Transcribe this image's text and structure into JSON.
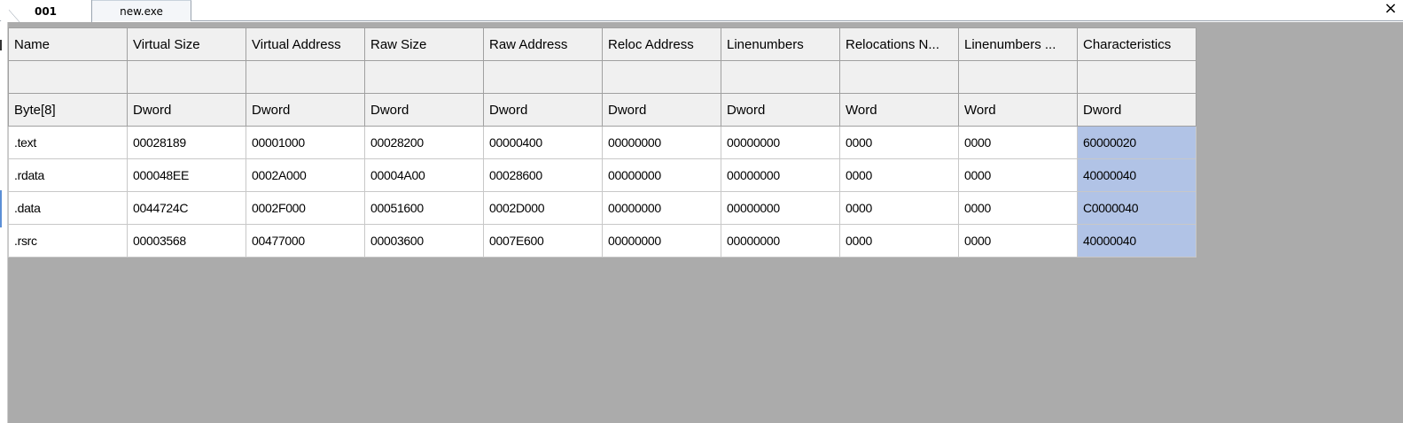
{
  "tabs": [
    {
      "label": "001",
      "active": true
    },
    {
      "label": "new.exe",
      "active": false
    }
  ],
  "close_icon": "×",
  "table": {
    "columns": [
      "Name",
      "Virtual Size",
      "Virtual Address",
      "Raw Size",
      "Raw Address",
      "Reloc Address",
      "Linenumbers",
      "Relocations N...",
      "Linenumbers ...",
      "Characteristics"
    ],
    "types": [
      "Byte[8]",
      "Dword",
      "Dword",
      "Dword",
      "Dword",
      "Dword",
      "Dword",
      "Word",
      "Word",
      "Dword"
    ],
    "rows": [
      [
        ".text",
        "00028189",
        "00001000",
        "00028200",
        "00000400",
        "00000000",
        "00000000",
        "0000",
        "0000",
        "60000020"
      ],
      [
        ".rdata",
        "000048EE",
        "0002A000",
        "00004A00",
        "00028600",
        "00000000",
        "00000000",
        "0000",
        "0000",
        "40000040"
      ],
      [
        ".data",
        "0044724C",
        "0002F000",
        "00051600",
        "0002D000",
        "00000000",
        "00000000",
        "0000",
        "0000",
        "C0000040"
      ],
      [
        ".rsrc",
        "00003568",
        "00477000",
        "00003600",
        "0007E600",
        "00000000",
        "00000000",
        "0000",
        "0000",
        "40000040"
      ]
    ],
    "selected_column": "Characteristics"
  },
  "colors": {
    "background": "#ababab",
    "header": "#f0f0f0",
    "selection": "#b1c3e6"
  }
}
